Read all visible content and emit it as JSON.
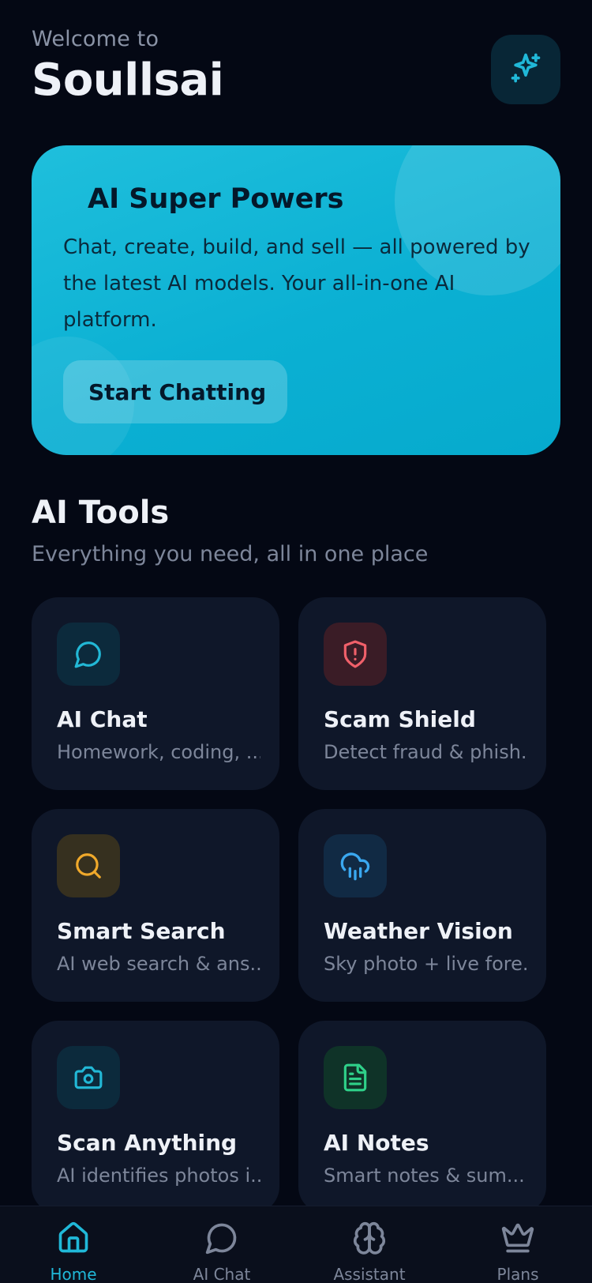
{
  "header": {
    "welcome": "Welcome to",
    "app_name": "Soullsai",
    "sparkle_icon": "sparkles-icon"
  },
  "hero": {
    "title": "AI Super Powers",
    "description": "Chat, create, build, and sell — all powered by the latest AI models. Your all-in-one AI platform.",
    "button_label": "Start Chatting"
  },
  "tools_section": {
    "title": "AI Tools",
    "subtitle": "Everything you need, all in one place",
    "cards": [
      {
        "title": "AI Chat",
        "subtitle": "Homework, coding, ...",
        "icon": "chat-bubble-icon",
        "color": "#22b8d6"
      },
      {
        "title": "Scam Shield",
        "subtitle": "Detect fraud & phish...",
        "icon": "shield-alert-icon",
        "color": "#f0606a"
      },
      {
        "title": "Smart Search",
        "subtitle": "AI web search & ans...",
        "icon": "search-icon",
        "color": "#f0a92b"
      },
      {
        "title": "Weather Vision",
        "subtitle": "Sky photo + live fore...",
        "icon": "cloud-rain-icon",
        "color": "#3aa8f0"
      },
      {
        "title": "Scan Anything",
        "subtitle": "AI identifies photos i...",
        "icon": "camera-icon",
        "color": "#22b8d6"
      },
      {
        "title": "AI Notes",
        "subtitle": "Smart notes & sum...",
        "icon": "file-text-icon",
        "color": "#2fd089"
      }
    ]
  },
  "bottom_nav": {
    "items": [
      {
        "label": "Home",
        "icon": "home-icon",
        "active": true
      },
      {
        "label": "AI Chat",
        "icon": "chat-bubble-icon",
        "active": false
      },
      {
        "label": "Assistant",
        "icon": "brain-icon",
        "active": false
      },
      {
        "label": "Plans",
        "icon": "crown-icon",
        "active": false
      }
    ]
  },
  "colors": {
    "background": "#040814",
    "accent": "#20b8d8",
    "card": "#0f1729"
  }
}
